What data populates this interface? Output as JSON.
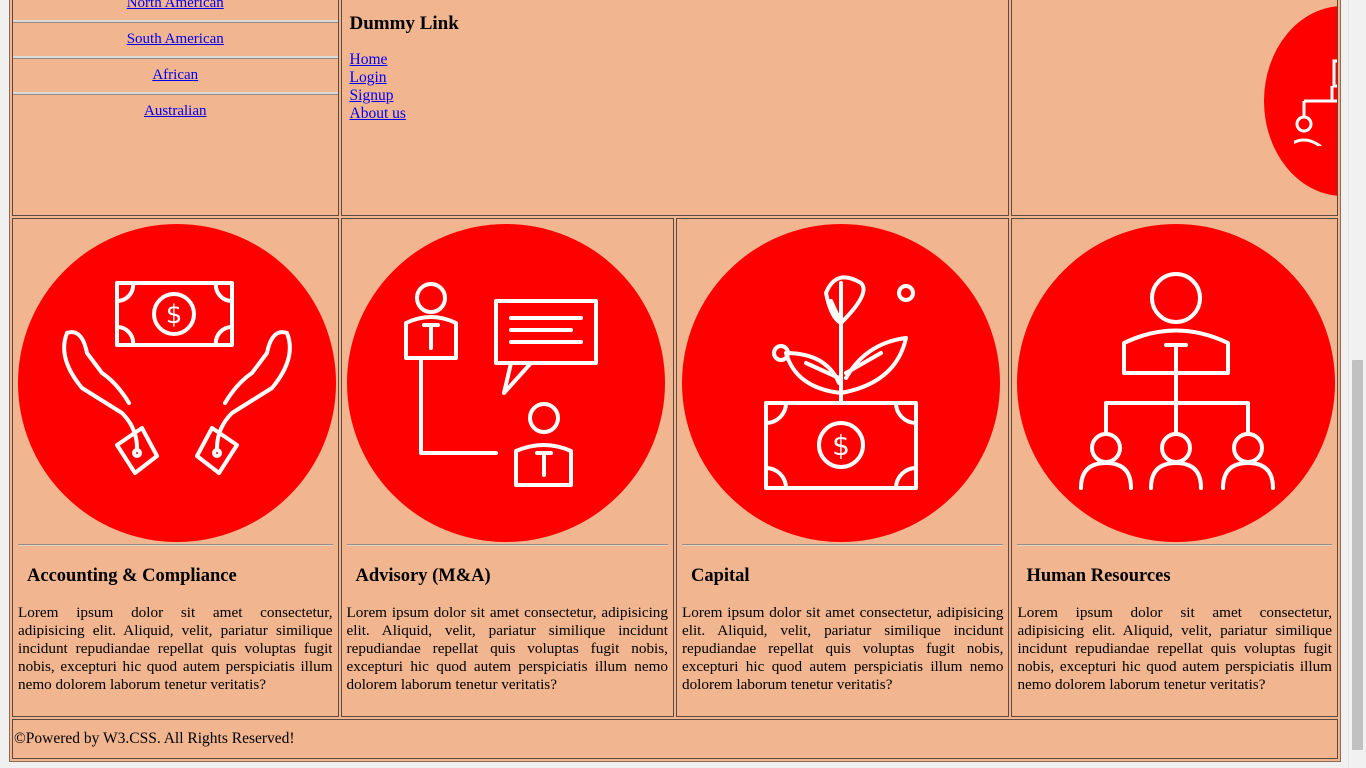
{
  "regions": [
    "North American",
    "South American",
    "African",
    "Australian"
  ],
  "dummy": {
    "heading": "Dummy Link",
    "links": [
      "Home",
      "Login",
      "Signup",
      "About us"
    ]
  },
  "services": [
    {
      "title": "Accounting & Compliance",
      "icon": "hands-money-icon",
      "text": "Lorem ipsum dolor sit amet consectetur, adipisicing elit. Aliquid, velit, pariatur similique incidunt repudiandae repellat quis voluptas fugit nobis, excepturi hic quod autem perspiciatis illum nemo dolorem laborum tenetur veritatis?"
    },
    {
      "title": "Advisory (M&A)",
      "icon": "advisory-consultation-icon",
      "text": "Lorem ipsum dolor sit amet consectetur, adipisicing elit. Aliquid, velit, pariatur similique incidunt repudiandae repellat quis voluptas fugit nobis, excepturi hic quod autem perspiciatis illum nemo dolorem laborum tenetur veritatis?"
    },
    {
      "title": "Capital",
      "icon": "plant-money-icon",
      "text": "Lorem ipsum dolor sit amet consectetur, adipisicing elit. Aliquid, velit, pariatur similique incidunt repudiandae repellat quis voluptas fugit nobis, excepturi hic quod autem perspiciatis illum nemo dolorem laborum tenetur veritatis?"
    },
    {
      "title": "Human Resources",
      "icon": "org-chart-icon",
      "text": "Lorem ipsum dolor sit amet consectetur, adipisicing elit. Aliquid, velit, pariatur similique incidunt repudiandae repellat quis voluptas fugit nobis, excepturi hic quod autem perspiciatis illum nemo dolorem laborum tenetur veritatis?"
    }
  ],
  "footer": {
    "text": "©Powered by W3.CSS. All Rights Reserved!"
  },
  "colors": {
    "background": "#f1b58f",
    "accent": "#ff0000",
    "link": "#0000ee"
  }
}
